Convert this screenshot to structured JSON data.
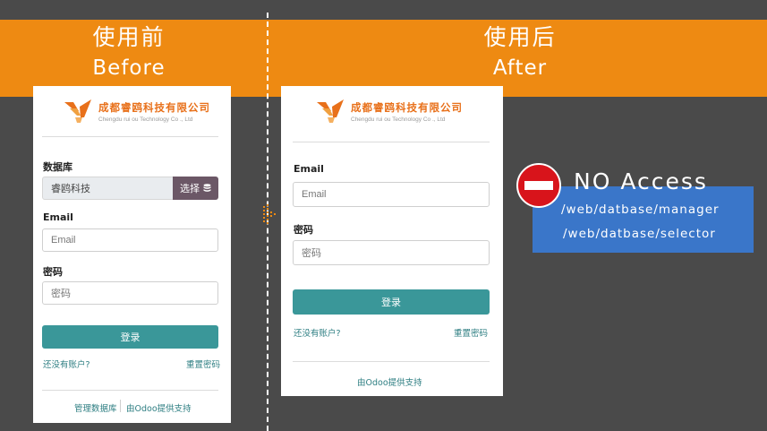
{
  "banner": {
    "before_zh": "使用前",
    "before_en": "Before",
    "after_zh": "使用后",
    "after_en": "After",
    "color": "#ee8a12"
  },
  "company": {
    "name": "成都睿鸥科技有限公司",
    "subtitle": "Chengdu rui ou Technology Co ., Ltd"
  },
  "before_form": {
    "database_label": "数据库",
    "database_value": "睿鸥科技",
    "select_button": "选择",
    "email_label": "Email",
    "email_placeholder": "Email",
    "password_label": "密码",
    "password_placeholder": "密码",
    "login_button": "登录",
    "no_account_link": "还没有账户?",
    "reset_password_link": "重置密码",
    "manage_db_link": "管理数据库",
    "powered_by_link": "由Odoo提供支持"
  },
  "after_form": {
    "email_label": "Email",
    "email_placeholder": "Email",
    "password_label": "密码",
    "password_placeholder": "密码",
    "login_button": "登录",
    "no_account_link": "还没有账户?",
    "reset_password_link": "重置密码",
    "powered_by_link": "由Odoo提供支持"
  },
  "no_access": {
    "title": "NO Access",
    "paths": [
      "/web/datbase/manager",
      "/web/datbase/selector"
    ],
    "box_color": "#3a76c9",
    "icon": "no-entry-icon"
  },
  "colors": {
    "primary": "#3a9799",
    "select_button": "#6b5766",
    "background": "#4a4a4a"
  }
}
